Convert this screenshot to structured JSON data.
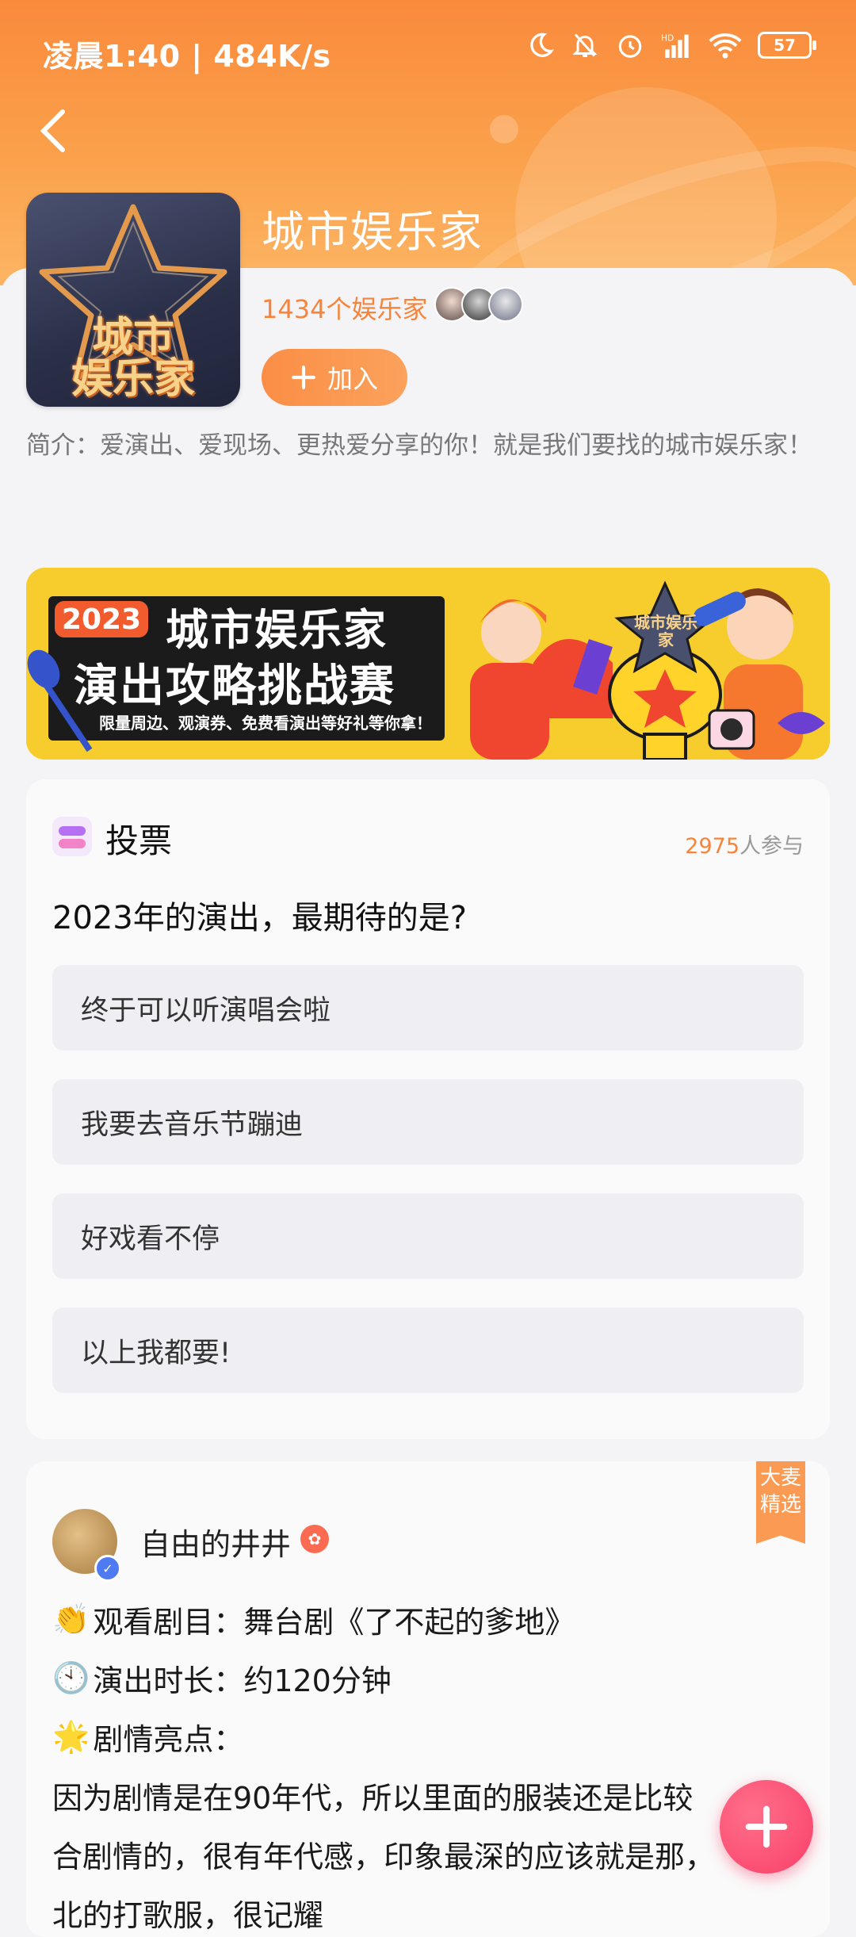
{
  "status_bar": {
    "time_speed": "凌晨1:40 | 484K/s",
    "battery": "57"
  },
  "group": {
    "title": "城市娱乐家",
    "member_count": "1434个娱乐家",
    "join_label": "加入",
    "intro": "简介：爱演出、爱现场、更热爱分享的你！就是我们要找的城市娱乐家！",
    "logo_text_1": "城市",
    "logo_text_2": "娱乐家"
  },
  "banner": {
    "year": "2023",
    "title_1": "城市娱乐家",
    "title_2": "演出攻略挑战赛",
    "subtitle": "限量周边、观演券、免费看演出等好礼等你拿！",
    "trophy_text": "城市娱乐家"
  },
  "vote": {
    "label": "投票",
    "participants_num": "2975",
    "participants_suffix": "人参与",
    "question": "2023年的演出，最期待的是?",
    "options": [
      "终于可以听演唱会啦",
      "我要去音乐节蹦迪",
      "好戏看不停",
      "以上我都要!"
    ]
  },
  "post": {
    "author": "自由的井井",
    "featured_tag": "大麦精选",
    "lines": [
      {
        "emoji": "👏",
        "text": "观看剧目：舞台剧《了不起的爹地》"
      },
      {
        "emoji": "🕙",
        "text": "演出时长：约120分钟"
      },
      {
        "emoji": "🌟",
        "text": "剧情亮点："
      }
    ],
    "body_1": "因为剧情是在90年代，所以里面的服装还是比较",
    "body_2": "合剧情的，很有年代感，印象最深的应该就是那，",
    "body_3": "北的打歌服，很记耀"
  },
  "colors": {
    "accent": "#f6843b",
    "fab": "#f93f69"
  }
}
